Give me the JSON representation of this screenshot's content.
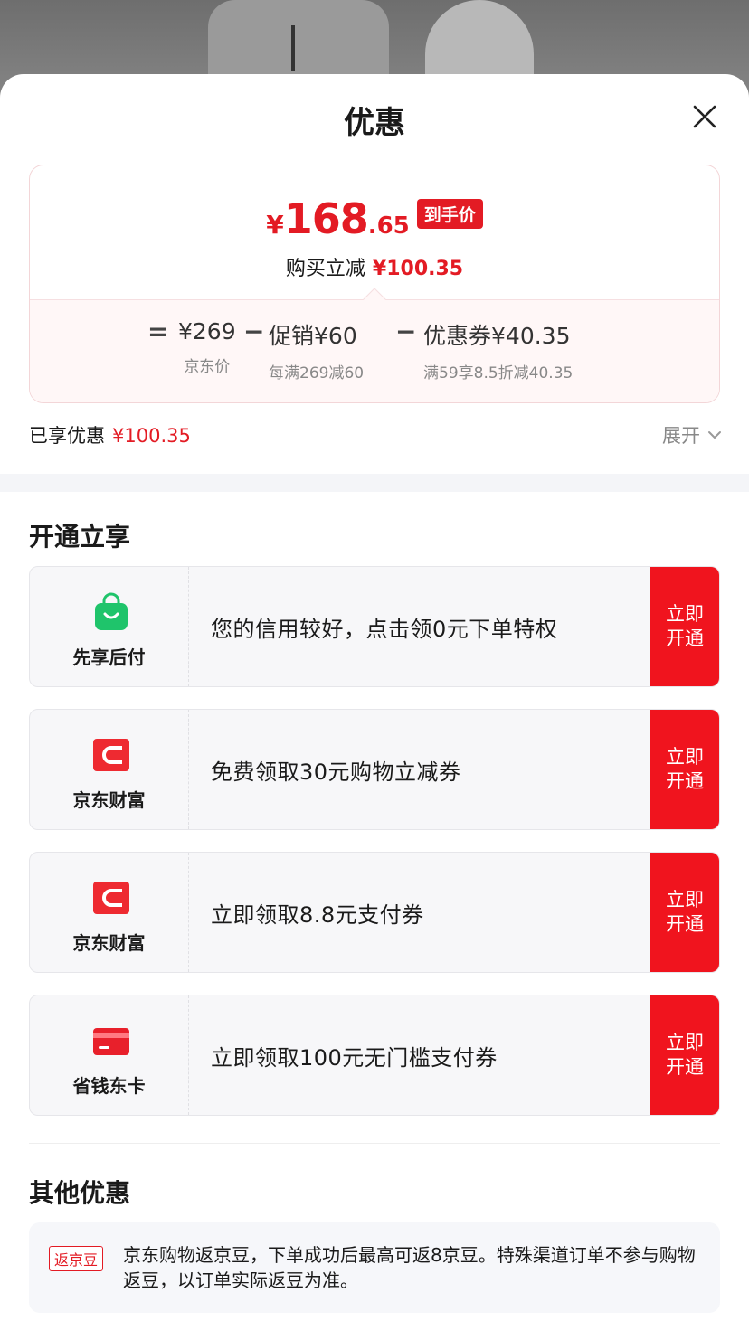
{
  "sheet": {
    "title": "优惠"
  },
  "price_card": {
    "yen": "¥",
    "price_int": "168",
    "price_dec": ".65",
    "price_tag": "到手价",
    "reduce_label": "购买立减",
    "reduce_value": "¥100.35",
    "breakdown": {
      "eq_op": "=",
      "jd_price": "¥269",
      "jd_price_label": "京东价",
      "minus_op_1": "−",
      "promo_label": "促销",
      "promo_value": "¥60",
      "promo_desc": "每满269减60",
      "minus_op_2": "−",
      "coupon_label": "优惠券",
      "coupon_value": "¥40.35",
      "coupon_desc": "满59享8.5折减40.35"
    }
  },
  "enjoyed": {
    "label": "已享优惠",
    "value": "¥100.35"
  },
  "expand_label": "展开",
  "open_section": {
    "title": "开通立享",
    "offers": [
      {
        "name": "先享后付",
        "icon": "shopping-bag-icon",
        "text": "您的信用较好，点击领0元下单特权",
        "button": "立即开通"
      },
      {
        "name": "京东财富",
        "icon": "jd-wealth-icon",
        "text": "免费领取30元购物立减券",
        "button": "立即开通"
      },
      {
        "name": "京东财富",
        "icon": "jd-wealth-icon",
        "text": "立即领取8.8元支付券",
        "button": "立即开通"
      },
      {
        "name": "省钱东卡",
        "icon": "card-icon",
        "text": "立即领取100元无门槛支付券",
        "button": "立即开通"
      }
    ]
  },
  "other_section": {
    "title": "其他优惠",
    "badge": "返京豆",
    "text": "京东购物返京豆，下单成功后最高可返8京豆。特殊渠道订单不参与购物返豆，以订单实际返豆为准。"
  },
  "colors": {
    "accent": "#e31b24",
    "button_red": "#f0141e",
    "wallet_green": "#1fc46b"
  }
}
